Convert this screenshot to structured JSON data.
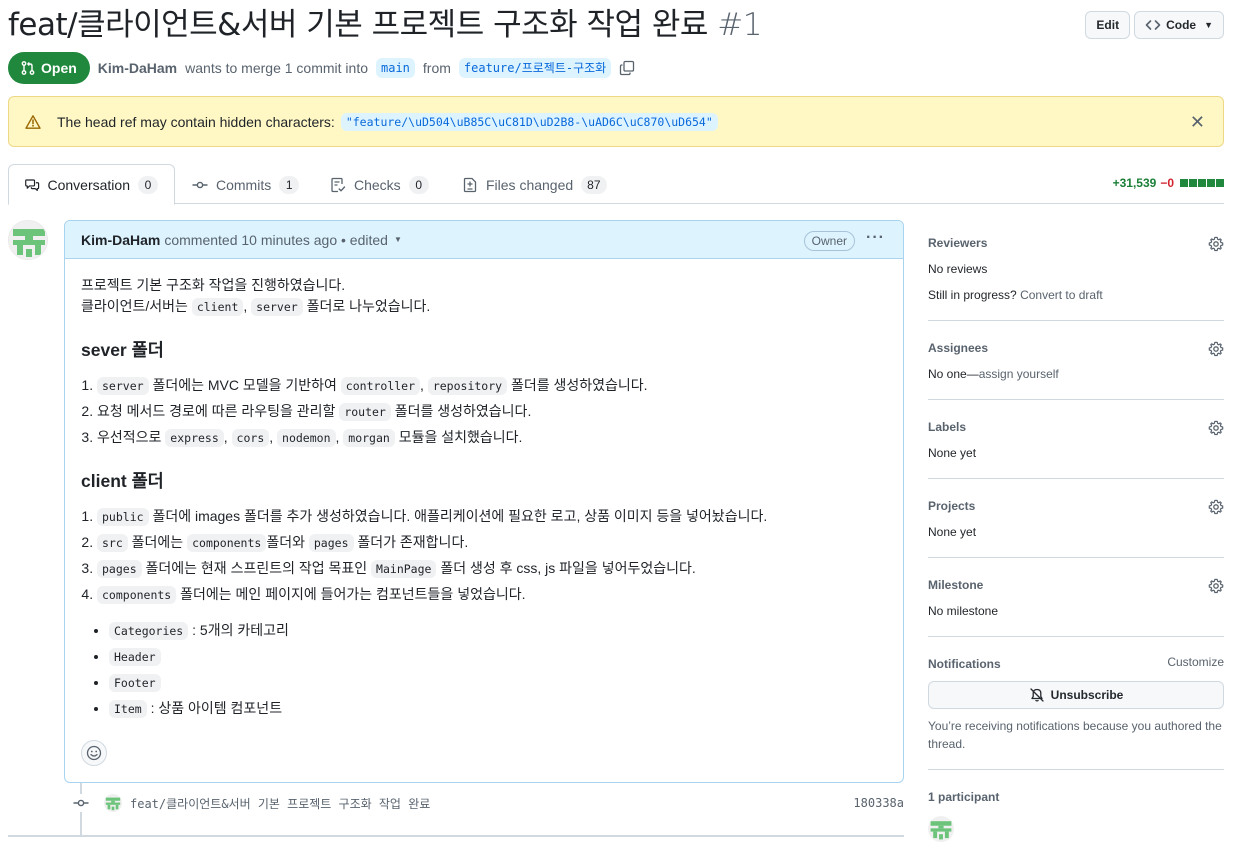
{
  "title": {
    "text": "feat/클라이언트&서버 기본 프로젝트 구조화 작업 완료",
    "number": "#1"
  },
  "header_buttons": {
    "edit": "Edit",
    "code": "Code"
  },
  "state": {
    "badge": "Open",
    "author": "Kim-DaHam",
    "text1": "wants to merge 1 commit into",
    "base_branch": "main",
    "text2": "from",
    "head_branch": "feature/프로젝트-구조화"
  },
  "banner": {
    "text": "The head ref may contain hidden characters:",
    "code": "\"feature/\\uD504\\uB85C\\uC81D\\uD2B8-\\uAD6C\\uC870\\uD654\""
  },
  "tabs": [
    {
      "label": "Conversation",
      "count": "0"
    },
    {
      "label": "Commits",
      "count": "1"
    },
    {
      "label": "Checks",
      "count": "0"
    },
    {
      "label": "Files changed",
      "count": "87"
    }
  ],
  "diffstat": {
    "additions": "+31,539",
    "deletions": "−0"
  },
  "comment": {
    "author": "Kim-DaHam",
    "meta": "commented 10 minutes ago • edited",
    "role": "Owner",
    "intro1": "프로젝트 기본 구조화 작업을 진행하였습니다.",
    "intro2_a": "클라이언트/서버는",
    "intro2_code1": "client",
    "intro2_sep": ",",
    "intro2_code2": "server",
    "intro2_b": "폴더로 나누었습니다.",
    "h_server": "sever 폴더",
    "server_items": {
      "i1_code": "server",
      "i1_a": "폴더에는 MVC 모델을 기반하여",
      "i1_code2": "controller",
      "i1_sep": ",",
      "i1_code3": "repository",
      "i1_b": "폴더를 생성하였습니다.",
      "i2_a": "요청 메서드 경로에 따른 라우팅을 관리할",
      "i2_code": "router",
      "i2_b": "폴더를 생성하였습니다.",
      "i3_a": "우선적으로",
      "i3_c1": "express",
      "i3_c2": "cors",
      "i3_c3": "nodemon",
      "i3_c4": "morgan",
      "i3_b": "모듈을 설치했습니다.",
      "i3_sep": ","
    },
    "h_client": "client 폴더",
    "client_items": {
      "i1_code": "public",
      "i1_text": "폴더에 images 폴더를 추가 생성하였습니다. 애플리케이션에 필요한 로고, 상품 이미지 등을 넣어놨습니다.",
      "i2_code": "src",
      "i2_a": "폴더에는",
      "i2_code2": "components",
      "i2_b": "폴더와",
      "i2_code3": "pages",
      "i2_c": "폴더가 존재합니다.",
      "i3_code": "pages",
      "i3_a": "폴더에는 현재 스프린트의 작업 목표인",
      "i3_code2": "MainPage",
      "i3_b": "폴더 생성 후 css, js 파일을 넣어두었습니다.",
      "i4_code": "components",
      "i4_text": "폴더에는 메인 페이지에 들어가는 컴포넌트들을 넣었습니다."
    },
    "bullets": {
      "b1_code": "Categories",
      "b1_text": ": 5개의 카테고리",
      "b2_code": "Header",
      "b3_code": "Footer",
      "b4_code": "Item",
      "b4_text": ": 상품 아이템 컴포넌트"
    }
  },
  "commit": {
    "message": "feat/클라이언트&서버 기본 프로젝트 구조화 작업 완료",
    "sha": "180338a"
  },
  "sidebar": {
    "reviewers": {
      "label": "Reviewers",
      "value": "No reviews",
      "progress_a": "Still in progress?",
      "progress_b": "Convert to draft"
    },
    "assignees": {
      "label": "Assignees",
      "value_a": "No one—",
      "value_b": "assign yourself"
    },
    "labels": {
      "label": "Labels",
      "value": "None yet"
    },
    "projects": {
      "label": "Projects",
      "value": "None yet"
    },
    "milestone": {
      "label": "Milestone",
      "value": "No milestone"
    },
    "notifications": {
      "label": "Notifications",
      "customize": "Customize",
      "button": "Unsubscribe",
      "note": "You’re receiving notifications because you authored the thread."
    },
    "participants": {
      "label": "1 participant"
    }
  },
  "colors": {
    "open_green": "#1f883d",
    "link_blue": "#0969da",
    "banner_yellow": "#fff8c5",
    "comment_header": "#ddf4ff"
  },
  "icons": [
    "git-pull-request-icon",
    "copy-icon",
    "alert-icon",
    "close-icon",
    "comment-discussion-icon",
    "git-commit-icon",
    "checklist-icon",
    "file-diff-icon",
    "kebab-icon",
    "smiley-icon",
    "gear-icon",
    "bell-slash-icon",
    "code-icon"
  ]
}
